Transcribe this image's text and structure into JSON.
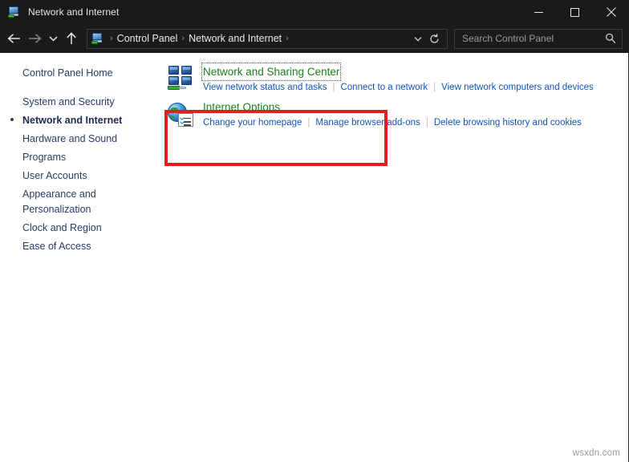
{
  "window": {
    "title": "Network and Internet",
    "icon": "network-computer-icon",
    "controls": {
      "minimize": "minimize-icon",
      "maximize": "maximize-icon",
      "close": "close-icon"
    }
  },
  "toolbar": {
    "back": "back-arrow-icon",
    "forward": "forward-arrow-icon",
    "recent": "chevron-down-icon",
    "up": "up-arrow-icon",
    "address": {
      "icon": "network-computer-icon",
      "crumbs": [
        "Control Panel",
        "Network and Internet"
      ],
      "separator": "›",
      "dropdown": "chevron-down-icon",
      "refresh": "refresh-icon"
    },
    "search": {
      "placeholder": "Search Control Panel",
      "icon": "search-icon"
    }
  },
  "sidebar": {
    "items": [
      {
        "label": "Control Panel Home",
        "current": false
      },
      {
        "label": "System and Security",
        "current": false
      },
      {
        "label": "Network and Internet",
        "current": true
      },
      {
        "label": "Hardware and Sound",
        "current": false
      },
      {
        "label": "Programs",
        "current": false
      },
      {
        "label": "User Accounts",
        "current": false
      },
      {
        "label": "Appearance and Personalization",
        "current": false
      },
      {
        "label": "Clock and Region",
        "current": false
      },
      {
        "label": "Ease of Access",
        "current": false
      }
    ]
  },
  "content": {
    "categories": [
      {
        "title": "Network and Sharing Center",
        "icon": "network-sharing-center-icon",
        "focused": true,
        "links": [
          "View network status and tasks",
          "Connect to a network",
          "View network computers and devices"
        ]
      },
      {
        "title": "Internet Options",
        "icon": "internet-options-icon",
        "focused": false,
        "links": [
          "Change your homepage",
          "Manage browser add-ons",
          "Delete browsing history and cookies"
        ]
      }
    ]
  },
  "annotation": {
    "highlight_color": "#e01f1f",
    "target": "Network and Sharing Center"
  },
  "watermark": "wsxdn.com"
}
